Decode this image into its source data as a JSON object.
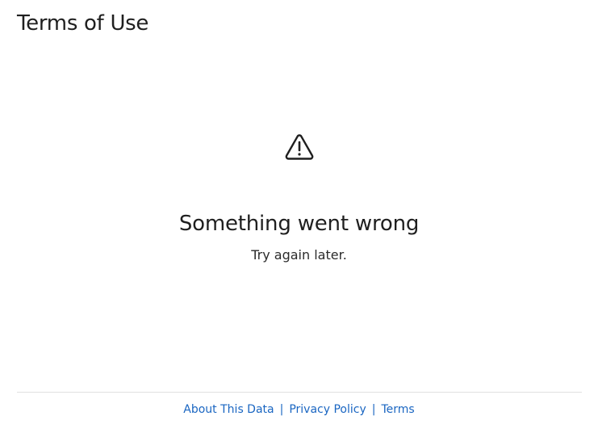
{
  "header": {
    "title": "Terms of Use"
  },
  "error": {
    "icon": "warning-triangle-icon",
    "heading": "Something went wrong",
    "message": "Try again later."
  },
  "footer": {
    "links": [
      {
        "label": "About This Data"
      },
      {
        "label": "Privacy Policy"
      },
      {
        "label": "Terms"
      }
    ],
    "separator": "|",
    "link_color": "#1a66c2"
  }
}
